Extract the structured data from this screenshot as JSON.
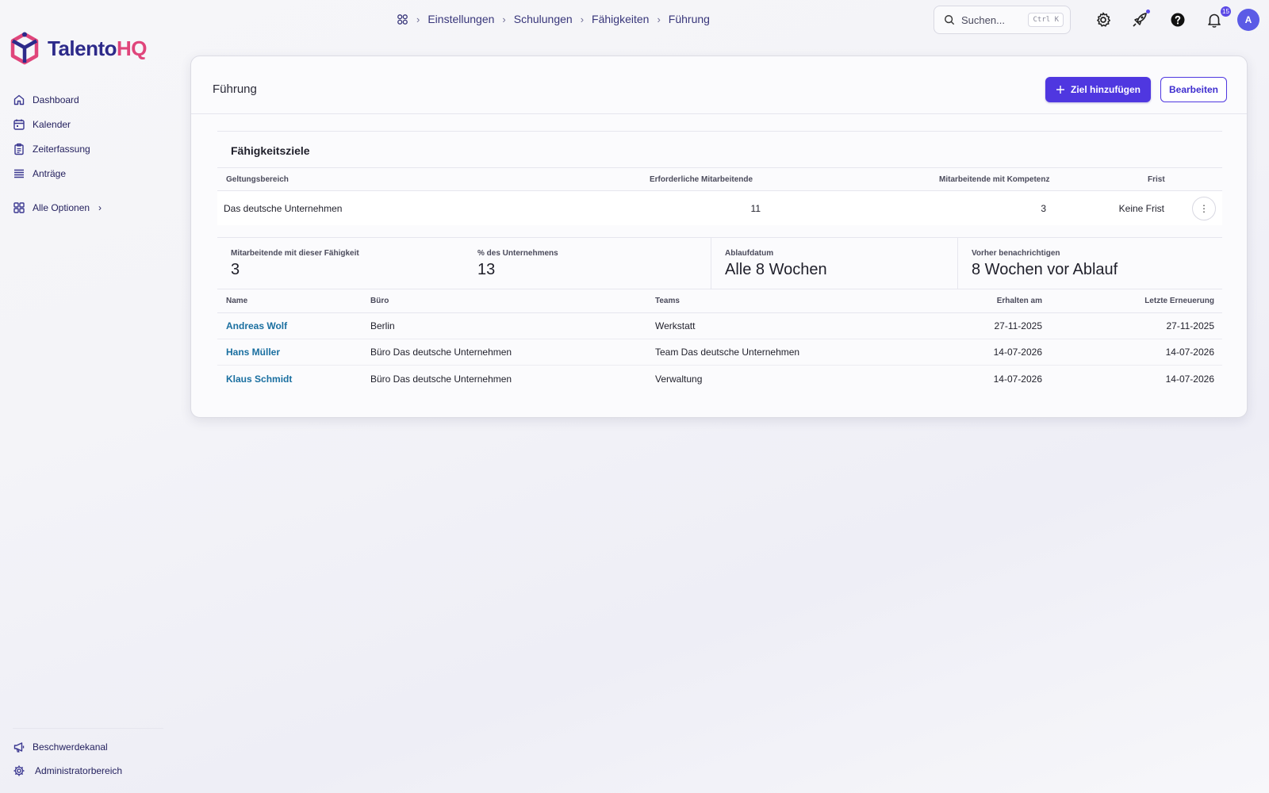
{
  "app": {
    "logo_part1": "Talento",
    "logo_part2": "HQ",
    "brand_colors": {
      "primary": "#2d2a8a",
      "accent": "#e0457b",
      "button": "#4f37e0",
      "link": "#1a6fa0"
    }
  },
  "sidebar": {
    "items": [
      {
        "label": "Dashboard",
        "icon": "home-icon"
      },
      {
        "label": "Kalender",
        "icon": "calendar-icon"
      },
      {
        "label": "Zeiterfassung",
        "icon": "clipboard-icon"
      },
      {
        "label": "Anträge",
        "icon": "list-icon"
      },
      {
        "label": "Alle Optionen",
        "icon": "grid-icon"
      }
    ],
    "footer": [
      {
        "label": "Beschwerdekanal",
        "icon": "megaphone-icon"
      },
      {
        "label": "Administratorbereich",
        "icon": "gear-icon"
      }
    ]
  },
  "breadcrumb": [
    "Einstellungen",
    "Schulungen",
    "Fähigkeiten",
    "Führung"
  ],
  "topbar": {
    "search_placeholder": "Suchen...",
    "search_shortcut": "Ctrl K",
    "notification_count": "15",
    "avatar_initial": "A"
  },
  "card": {
    "title": "Führung",
    "add_goal_label": "Ziel hinzufügen",
    "edit_label": "Bearbeiten"
  },
  "goals": {
    "title": "Fähigkeitsziele",
    "headers": {
      "scope": "Geltungsbereich",
      "required": "Erforderliche Mitarbeitende",
      "competent": "Mitarbeitende mit Kompetenz",
      "deadline": "Frist"
    },
    "row": {
      "scope": "Das deutsche Unternehmen",
      "required": "11",
      "competent": "3",
      "deadline": "Keine Frist"
    }
  },
  "stats": [
    {
      "label": "Mitarbeitende mit dieser Fähigkeit",
      "value": "3"
    },
    {
      "label": "% des Unternehmens",
      "value": "13"
    },
    {
      "label": "Ablaufdatum",
      "value": "Alle 8 Wochen"
    },
    {
      "label": "Vorher benachrichtigen",
      "value": "8 Wochen vor Ablauf"
    }
  ],
  "employees": {
    "headers": {
      "name": "Name",
      "office": "Büro",
      "teams": "Teams",
      "received": "Erhalten am",
      "renewal": "Letzte Erneuerung"
    },
    "rows": [
      {
        "name": "Andreas Wolf",
        "office": "Berlin",
        "team": "Werkstatt",
        "received": "27-11-2025",
        "renewal": "27-11-2025"
      },
      {
        "name": "Hans Müller",
        "office": "Büro Das deutsche Unternehmen",
        "team": "Team Das deutsche Unternehmen",
        "received": "14-07-2026",
        "renewal": "14-07-2026"
      },
      {
        "name": "Klaus Schmidt",
        "office": "Büro Das deutsche Unternehmen",
        "team": "Verwaltung",
        "received": "14-07-2026",
        "renewal": "14-07-2026"
      }
    ]
  }
}
